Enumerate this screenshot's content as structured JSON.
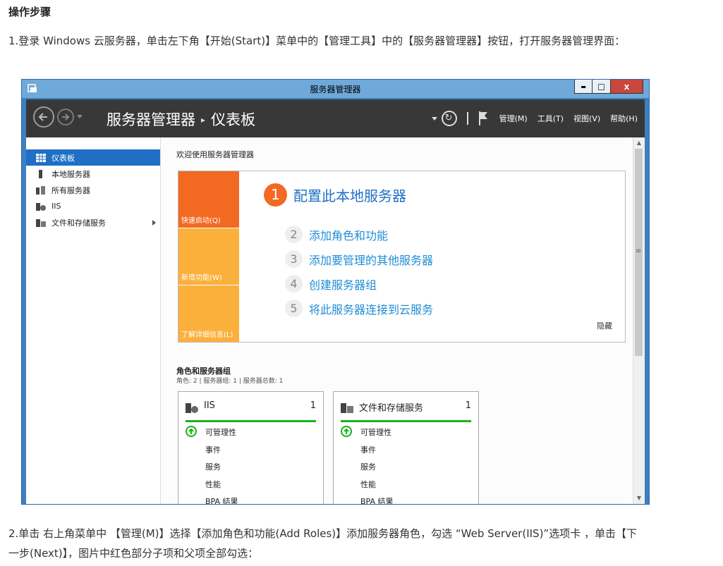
{
  "doc": {
    "heading": "操作步骤",
    "p1": "1.登录 Windows 云服务器，单击左下角【开始(Start)】菜单中的【管理工具】中的【服务器管理器】按钮，打开服务器管理界面：",
    "p2": "2.单击 右上角菜单中 【管理(M)】选择【添加角色和功能(Add Roles)】添加服务器角色，勾选 “Web Server(IIS)”选项卡 ，单击【下一步(Next)】，图片中红色部分子项和父项全部勾选："
  },
  "window": {
    "title": "服务器管理器",
    "buttons": {
      "minimize": "▬",
      "maximize": "□",
      "close": "x"
    }
  },
  "header": {
    "breadcrumb_root": "服务器管理器",
    "breadcrumb_sep": "▸",
    "breadcrumb_page": "仪表板",
    "menu": [
      "管理(M)",
      "工具(T)",
      "视图(V)",
      "帮助(H)"
    ]
  },
  "sidebar": {
    "items": [
      {
        "label": "仪表板"
      },
      {
        "label": "本地服务器"
      },
      {
        "label": "所有服务器"
      },
      {
        "label": "IIS"
      },
      {
        "label": "文件和存储服务"
      }
    ]
  },
  "main": {
    "welcome": "欢迎使用服务器管理器",
    "tiles": [
      "快速启动(Q)",
      "新增功能(W)",
      "了解详细信息(L)"
    ],
    "big_step": {
      "num": "1",
      "label": "配置此本地服务器"
    },
    "steps": [
      {
        "num": "2",
        "label": "添加角色和功能"
      },
      {
        "num": "3",
        "label": "添加要管理的其他服务器"
      },
      {
        "num": "4",
        "label": "创建服务器组"
      },
      {
        "num": "5",
        "label": "将此服务器连接到云服务"
      }
    ],
    "hide": "隐藏",
    "roles_title": "角色和服务器组",
    "roles_sub": "角色: 2 | 服务器组: 1 | 服务器总数: 1",
    "cards": [
      {
        "title": "IIS",
        "count": "1",
        "rows": [
          "可管理性",
          "事件",
          "服务",
          "性能",
          "BPA 结果"
        ]
      },
      {
        "title": "文件和存储服务",
        "count": "1",
        "rows": [
          "可管理性",
          "事件",
          "服务",
          "性能",
          "BPA 结果"
        ]
      }
    ]
  },
  "colors": {
    "accent": "#1f6fc5",
    "quick_start": "#f26a22",
    "tile": "#fbb03b",
    "ok": "#19b319"
  }
}
